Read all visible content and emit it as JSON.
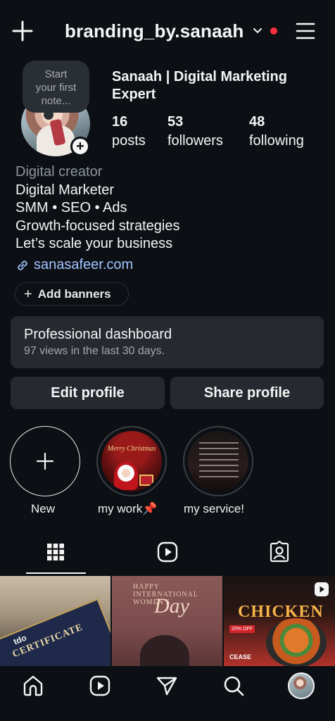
{
  "header": {
    "username": "branding_by.sanaah",
    "icons": [
      "plus-icon",
      "chevron-down-icon",
      "notification-dot",
      "menu-icon"
    ],
    "dot_color": "#ff3040"
  },
  "profile": {
    "note_placeholder": "Start\nyour first\nnote...",
    "display_name": "Sanaah | Digital Marketing Expert",
    "stats": [
      {
        "value": "16",
        "label": "posts"
      },
      {
        "value": "53",
        "label": "followers"
      },
      {
        "value": "48",
        "label": "following"
      }
    ],
    "category": "Digital creator",
    "bio_lines": [
      "Digital Marketer",
      "SMM • SEO • Ads",
      "Growth-focused strategies",
      "Let’s scale your business"
    ],
    "link": "sanasafeer.com",
    "link_color": "#a2c3ff",
    "add_banners": "Add banners"
  },
  "dashboard": {
    "title": "Professional dashboard",
    "subtitle": "97 views in the last 30 days."
  },
  "buttons": {
    "edit_profile": "Edit profile",
    "share_profile": "Share profile"
  },
  "highlights": [
    {
      "label": "New"
    },
    {
      "label": "my work📌",
      "image_text": "Merry Christmas"
    },
    {
      "label": "my service!"
    }
  ],
  "tabs": [
    "grid-icon",
    "reels-icon",
    "tagged-icon"
  ],
  "grid": [
    {
      "type": "post",
      "text": [
        "tdo",
        "CERTIFICATE"
      ]
    },
    {
      "type": "post",
      "text": [
        "HAPPY",
        "INTERNATIONAL",
        "WOMEN'S",
        "Day"
      ]
    },
    {
      "type": "reel",
      "text": [
        "CHICKEN",
        "20% OFF",
        "CEASE"
      ]
    }
  ],
  "bottom_nav": [
    "home-icon",
    "reels-icon",
    "send-icon",
    "search-icon",
    "profile-avatar"
  ]
}
